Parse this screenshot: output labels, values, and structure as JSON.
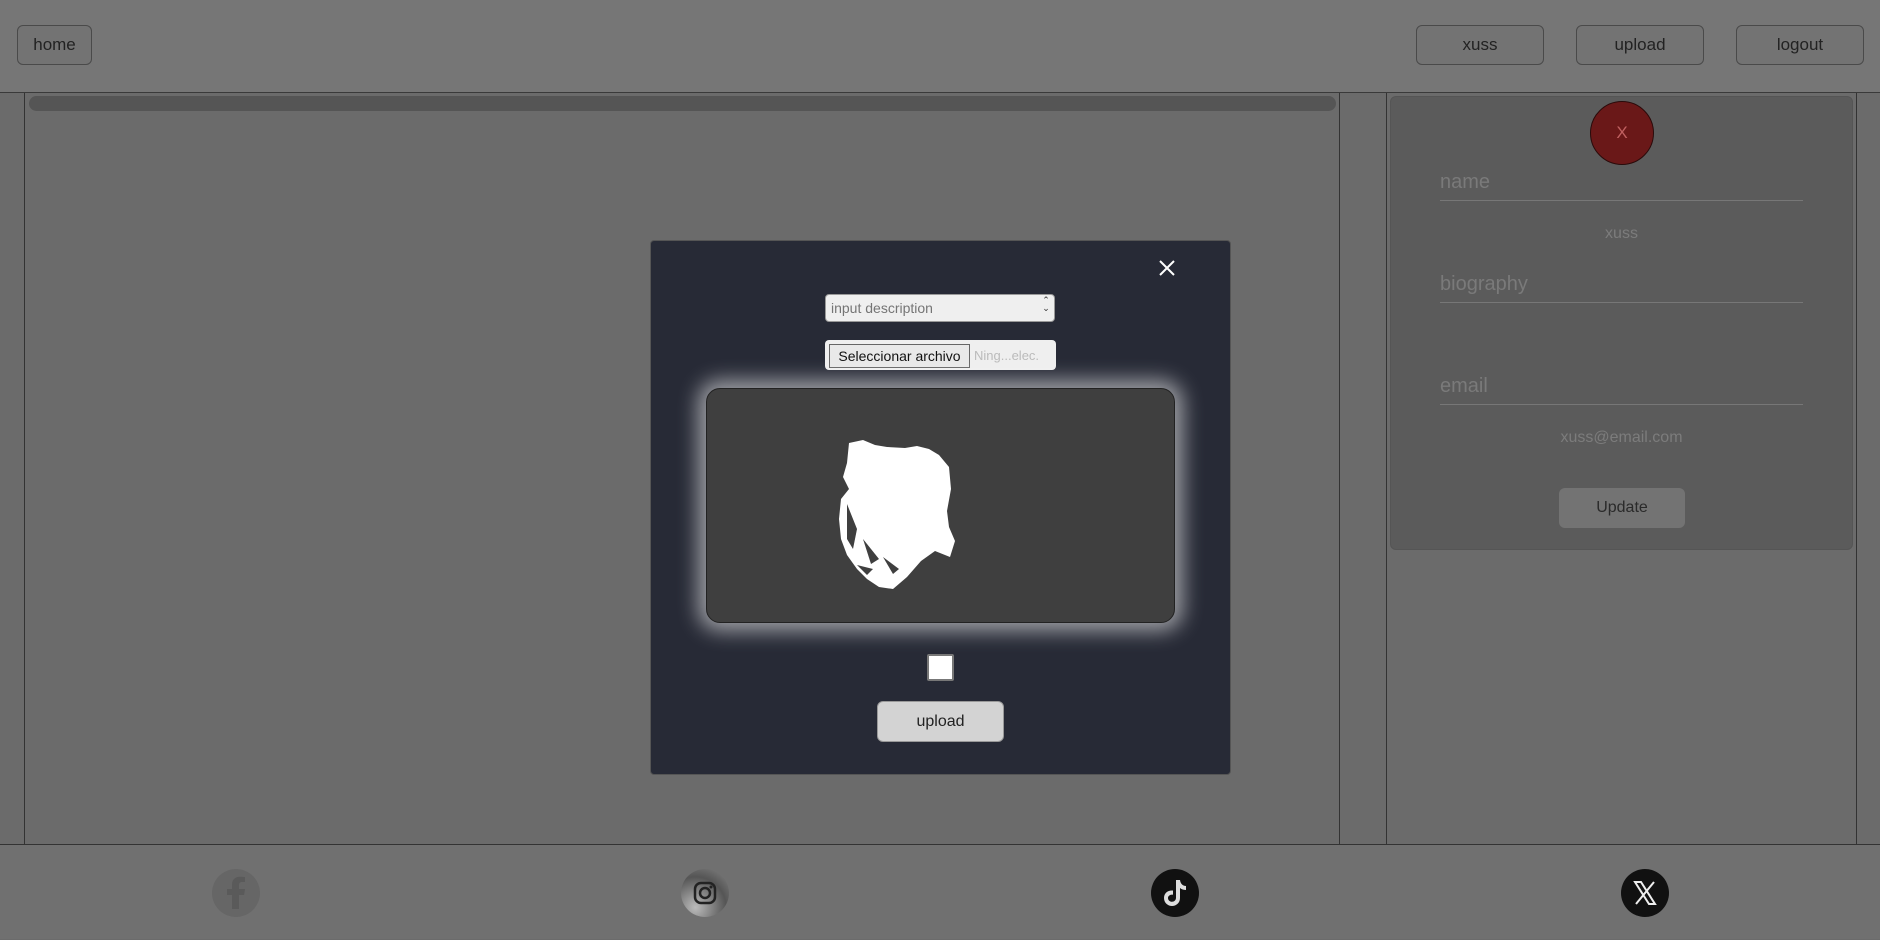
{
  "header": {
    "home_label": "home",
    "user_label": "xuss",
    "upload_label": "upload",
    "logout_label": "logout"
  },
  "profile": {
    "avatar_initial": "X",
    "avatar_color": "#6a1818",
    "name_label": "name",
    "name_value": "xuss",
    "biography_label": "biography",
    "biography_value": "",
    "email_label": "email",
    "email_value": "xuss@email.com",
    "update_label": "Update"
  },
  "modal": {
    "close_icon": "close-icon",
    "description_placeholder": "input description",
    "file_button_label": "Seleccionar archivo",
    "file_name_text": "Ning...elec.",
    "preview_icon": "cannon-image",
    "checkbox_checked": false,
    "upload_label": "upload"
  },
  "footer": {
    "social_icons": [
      "facebook-icon",
      "instagram-icon",
      "tiktok-icon",
      "x-icon"
    ]
  }
}
